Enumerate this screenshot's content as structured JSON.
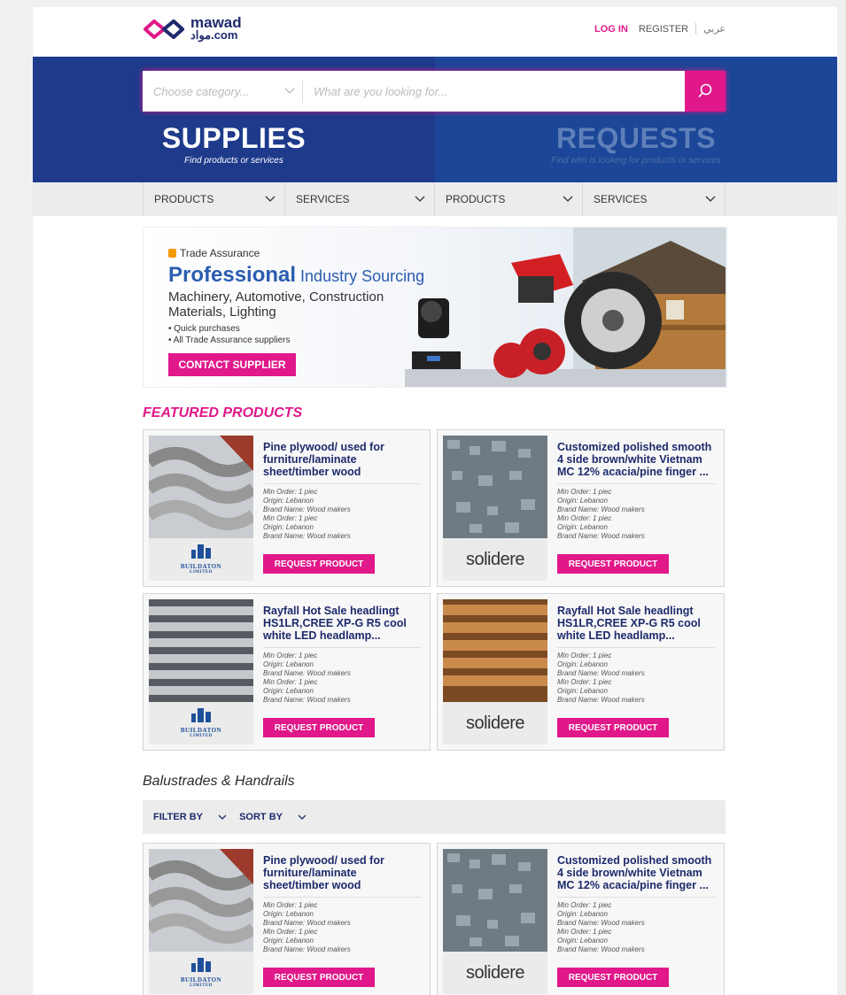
{
  "header": {
    "logo_en": "mawad",
    "logo_ar": "مواد.com",
    "login": "LOG IN",
    "register": "REGISTER",
    "lang": "عربي"
  },
  "search": {
    "category_placeholder": "Choose category...",
    "query_placeholder": "What are you looking for..."
  },
  "hero": {
    "supplies_title": "SUPPLIES",
    "supplies_sub": "Find products or services",
    "requests_title": "REQUESTS",
    "requests_sub": "Find who is looking for products or services"
  },
  "subnav": [
    "PRODUCTS",
    "SERVICES",
    "PRODUCTS",
    "SERVICES"
  ],
  "banner": {
    "trade": "Trade Assurance",
    "h1_bold": "Professional",
    "h1_rest": " Industry Sourcing",
    "h2": "Machinery, Automotive, Construction Materials, Lighting",
    "bullet1": "• Quick purchases",
    "bullet2": "• All Trade Assurance suppliers",
    "cta": "CONTACT SUPPLIER"
  },
  "featured_title": "FEATURED PRODUCTS",
  "listing_title": "Balustrades & Handrails",
  "filter": {
    "filter_by": "FILTER BY",
    "sort_by": "SORT BY"
  },
  "spec_lines": [
    "Min Order: 1 piec",
    "Origin: Lebanon",
    "Brand Name: Wood makers",
    "Min Order: 1 piec",
    "Origin: Lebanon",
    "Brand Name: Wood makers"
  ],
  "request_label": "REQUEST PRODUCT",
  "brands": {
    "buildaton": "BUILDATON",
    "buildaton_sub": "LIMITED",
    "solidere": "solidere"
  },
  "cards": [
    {
      "title": "Pine plywood/ used for furniture/laminate sheet/timber wood"
    },
    {
      "title": "Customized polished smooth 4 side brown/white Vietnam MC 12% acacia/pine finger ..."
    },
    {
      "title": "Rayfall Hot Sale headlingt HS1LR,CREE XP-G R5 cool white LED headlamp..."
    },
    {
      "title": "Rayfall Hot Sale headlingt HS1LR,CREE XP-G R5 cool white LED headlamp..."
    },
    {
      "title": "Pine plywood/ used for furniture/laminate sheet/timber wood"
    },
    {
      "title": "Customized polished smooth 4 side brown/white Vietnam MC 12% acacia/pine finger ..."
    }
  ],
  "colors": {
    "brand_pink": "#e0188a",
    "navy": "#1d3a8b",
    "blue": "#1c4697"
  }
}
